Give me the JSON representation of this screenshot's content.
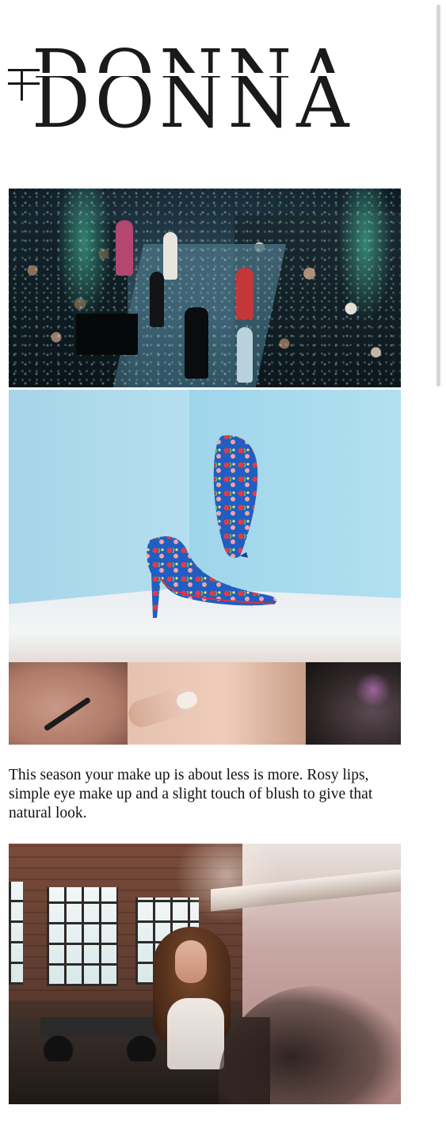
{
  "brand": {
    "name": "DONNA"
  },
  "images": [
    {
      "name": "runway-fashion-show-photo"
    },
    {
      "name": "floral-stiletto-shoe-photo"
    },
    {
      "name": "makeup-application-photo"
    },
    {
      "name": "woman-in-workshop-photo"
    }
  ],
  "article": {
    "text": "This season your make up is about less is more. Rosy lips, simple eye make up and a slight touch of blush to give that natural look."
  },
  "colors": {
    "text": "#111111",
    "background": "#ffffff"
  }
}
